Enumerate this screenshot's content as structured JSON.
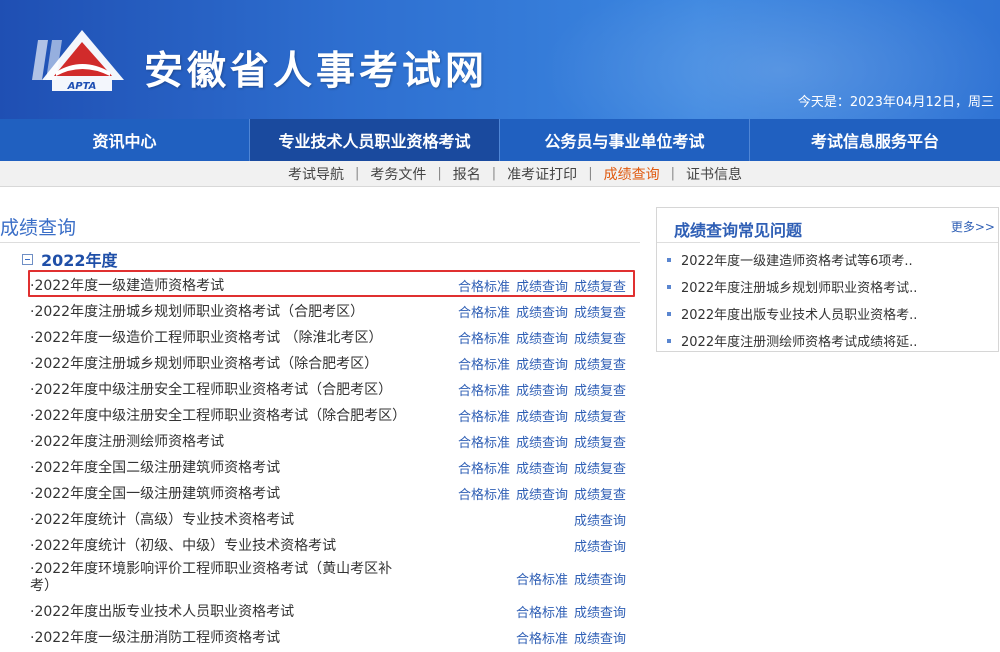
{
  "header": {
    "logo_text": "APTA",
    "site_title": "安徽省人事考试网",
    "date_text": "今天是：2023年04月12日，周三"
  },
  "main_nav": [
    {
      "label": "资讯中心"
    },
    {
      "label": "专业技术人员职业资格考试"
    },
    {
      "label": "公务员与事业单位考试"
    },
    {
      "label": "考试信息服务平台"
    }
  ],
  "sub_nav": [
    {
      "label": "考试导航"
    },
    {
      "label": "考务文件"
    },
    {
      "label": "报名"
    },
    {
      "label": "准考证打印"
    },
    {
      "label": "成绩查询"
    },
    {
      "label": "证书信息"
    }
  ],
  "separator": "|",
  "content": {
    "section_title": "成绩查询",
    "year": "2022年度",
    "bullet": "·",
    "exams": [
      {
        "name": "2022年度一级建造师资格考试",
        "links": [
          "合格标准",
          "成绩查询",
          "成绩复查"
        ]
      },
      {
        "name": "2022年度注册城乡规划师职业资格考试（合肥考区）",
        "links": [
          "合格标准",
          "成绩查询",
          "成绩复查"
        ]
      },
      {
        "name": "2022年度一级造价工程师职业资格考试 （除淮北考区）",
        "links": [
          "合格标准",
          "成绩查询",
          "成绩复查"
        ]
      },
      {
        "name": "2022年度注册城乡规划师职业资格考试（除合肥考区）",
        "links": [
          "合格标准",
          "成绩查询",
          "成绩复查"
        ]
      },
      {
        "name": "2022年度中级注册安全工程师职业资格考试（合肥考区）",
        "links": [
          "合格标准",
          "成绩查询",
          "成绩复查"
        ]
      },
      {
        "name": "2022年度中级注册安全工程师职业资格考试（除合肥考区）",
        "links": [
          "合格标准",
          "成绩查询",
          "成绩复查"
        ]
      },
      {
        "name": "2022年度注册测绘师资格考试",
        "links": [
          "合格标准",
          "成绩查询",
          "成绩复查"
        ]
      },
      {
        "name": "2022年度全国二级注册建筑师资格考试",
        "links": [
          "合格标准",
          "成绩查询",
          "成绩复查"
        ]
      },
      {
        "name": "2022年度全国一级注册建筑师资格考试",
        "links": [
          "合格标准",
          "成绩查询",
          "成绩复查"
        ]
      },
      {
        "name": "2022年度统计（高级）专业技术资格考试",
        "links": [
          "成绩查询"
        ]
      },
      {
        "name": "2022年度统计（初级、中级）专业技术资格考试",
        "links": [
          "成绩查询"
        ]
      },
      {
        "name": "2022年度环境影响评价工程师职业资格考试（黄山考区补考）",
        "links": [
          "合格标准",
          "成绩查询"
        ]
      },
      {
        "name": "2022年度出版专业技术人员职业资格考试",
        "links": [
          "合格标准",
          "成绩查询"
        ]
      },
      {
        "name": "2022年度一级注册消防工程师资格考试",
        "links": [
          "合格标准",
          "成绩查询"
        ]
      }
    ]
  },
  "sidebar": {
    "title": "成绩查询常见问题",
    "more": "更多>>",
    "items": [
      {
        "label": "2022年度一级建造师资格考试等6项考.."
      },
      {
        "label": "2022年度注册城乡规划师职业资格考试.."
      },
      {
        "label": "2022年度出版专业技术人员职业资格考.."
      },
      {
        "label": "2022年度注册测绘师资格考试成绩将延.."
      }
    ]
  },
  "colors": {
    "banner": "#2e6fd0",
    "nav": "#2060c0",
    "nav_active": "#1a4a9e",
    "link": "#2f5fb5",
    "subnav_active": "#e05a10",
    "highlight": "#e03030"
  }
}
